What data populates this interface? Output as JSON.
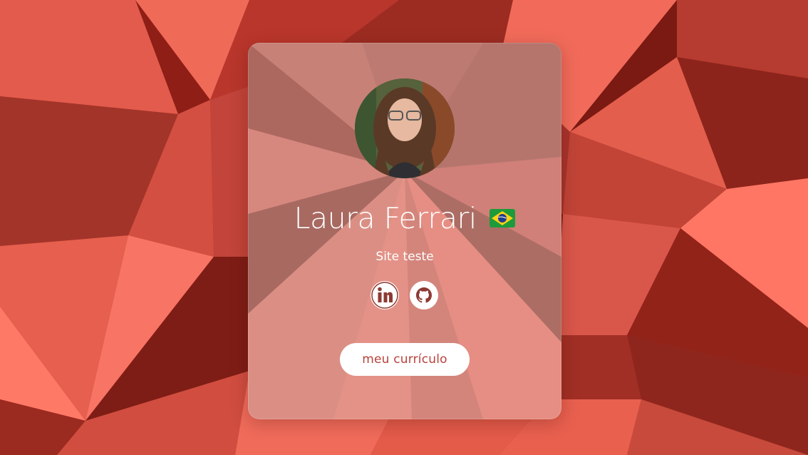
{
  "profile": {
    "name": "Laura Ferrari",
    "subtitle": "Site teste",
    "flag_emoji": "🇧🇷"
  },
  "social_links": [
    {
      "icon": "linkedin-icon",
      "label": "in"
    },
    {
      "icon": "github-icon"
    }
  ],
  "cta": {
    "label": "meu currículo"
  },
  "colors": {
    "background": "#a8342b",
    "accent": "#b9403a",
    "card_text": "#ffffff"
  }
}
